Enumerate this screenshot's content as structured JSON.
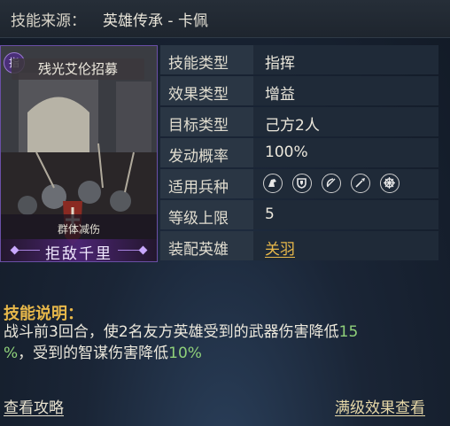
{
  "header": {
    "source_label": "技能来源：",
    "source_value": "英雄传承 - 卡佩"
  },
  "card": {
    "type_badge": "指",
    "name": "残光艾伦招募",
    "effect_tag": "群体减伤",
    "skill_name": "拒敌千里"
  },
  "attributes": [
    {
      "key": "技能类型",
      "value": "指挥"
    },
    {
      "key": "效果类型",
      "value": "增益"
    },
    {
      "key": "目标类型",
      "value": "己方2人"
    },
    {
      "key": "发动概率",
      "value": "100%"
    },
    {
      "key": "适用兵种",
      "icons": [
        "cavalry-icon",
        "shield-infantry-icon",
        "archer-icon",
        "spear-icon",
        "siege-icon"
      ]
    },
    {
      "key": "等级上限",
      "value": "5"
    },
    {
      "key": "装配英雄",
      "value": "关羽"
    }
  ],
  "description": {
    "title": "技能说明：",
    "line1_prefix": "战斗前3回合，使2名友方英雄受到的武器伤害降低",
    "value1_part1": "15",
    "value1_part2": "%",
    "line2_middle": "，受到的智谋伤害降低",
    "value2": "10%"
  },
  "links": {
    "guide": "查看攻略",
    "max_effect": "满级效果查看"
  },
  "colors": {
    "accent_gold": "#e8b84a",
    "highlight_green": "#8fd07a",
    "card_border": "#6a4fa6"
  }
}
